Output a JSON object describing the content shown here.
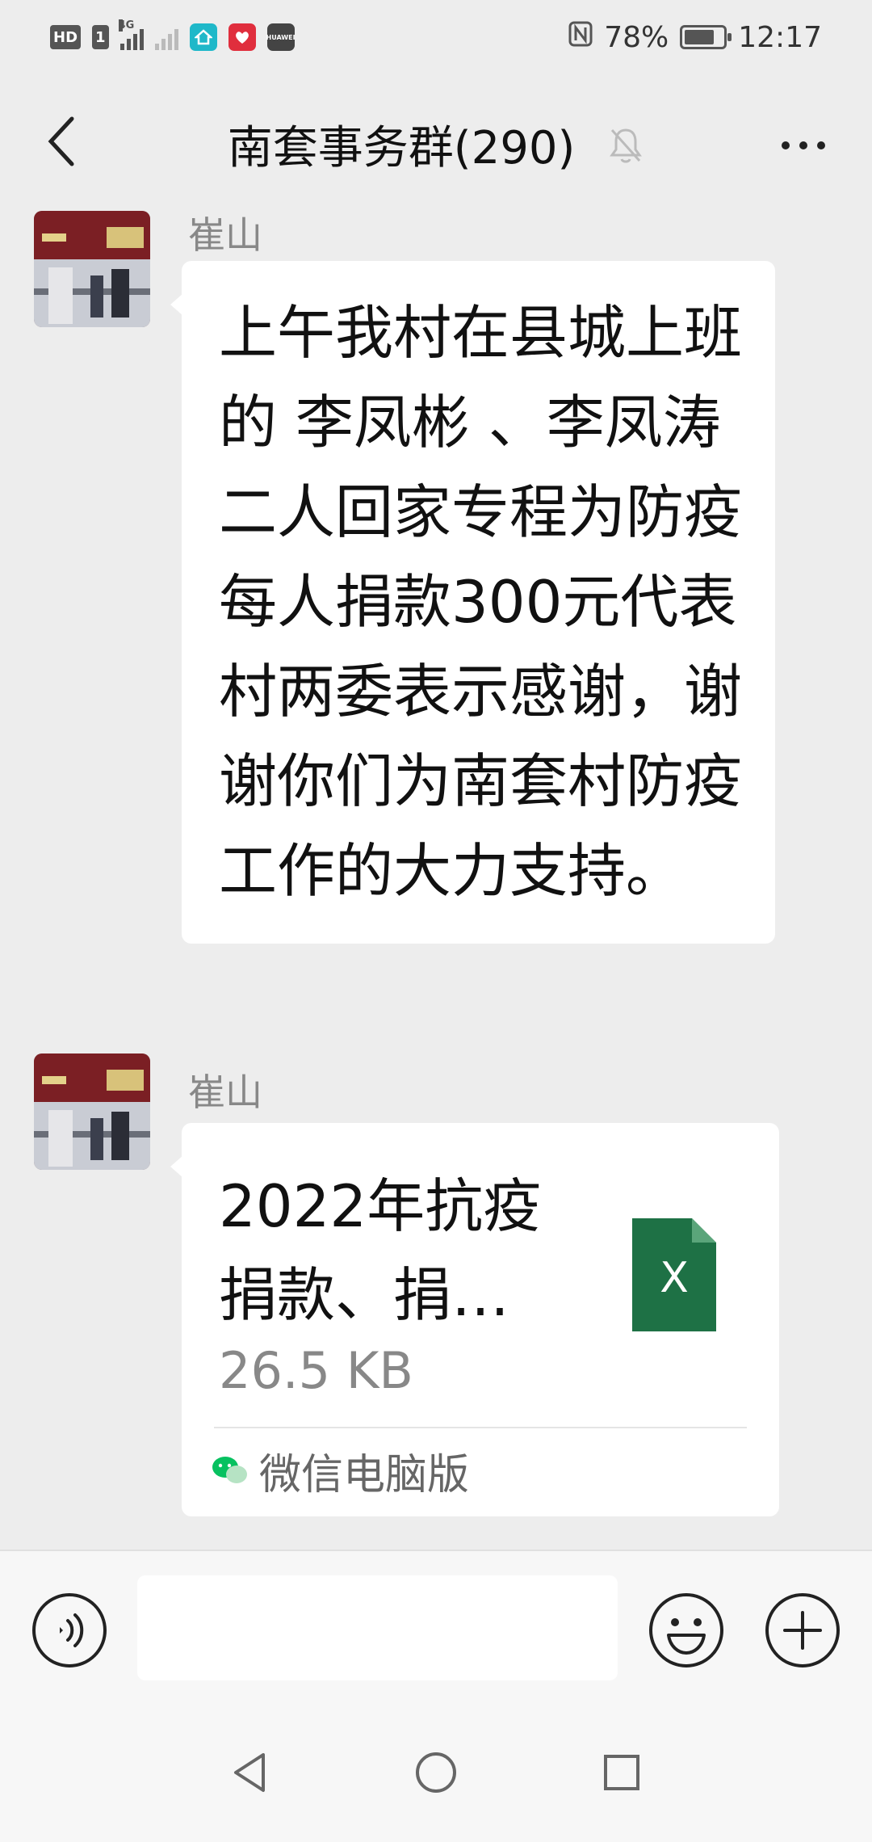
{
  "status_bar": {
    "hd_badge": "HD",
    "sim_badge": "1",
    "network_label": "4G",
    "carrier_app_label": "HUAWEI",
    "battery": "78%",
    "battery_level": 0.78,
    "time": "12:17"
  },
  "header": {
    "title": "南套事务群(290)",
    "muted": true
  },
  "messages": [
    {
      "sender": "崔山",
      "type": "text",
      "text": "上午我村在县城上班的  李凤彬 、李凤涛二人回家专程为防疫每人捐款300元代表村两委表示感谢，谢谢你们为南套村防疫工作的大力支持。"
    },
    {
      "sender": "崔山",
      "type": "file",
      "file_name": "2022年抗疫捐款、捐…",
      "file_size": "26.5 KB",
      "file_type_label": "X",
      "source": "微信电脑版"
    }
  ],
  "input_bar": {
    "placeholder": ""
  },
  "colors": {
    "background": "#ededed",
    "bubble": "#ffffff",
    "excel_green": "#1e7145",
    "wechat_green": "#07c160"
  }
}
